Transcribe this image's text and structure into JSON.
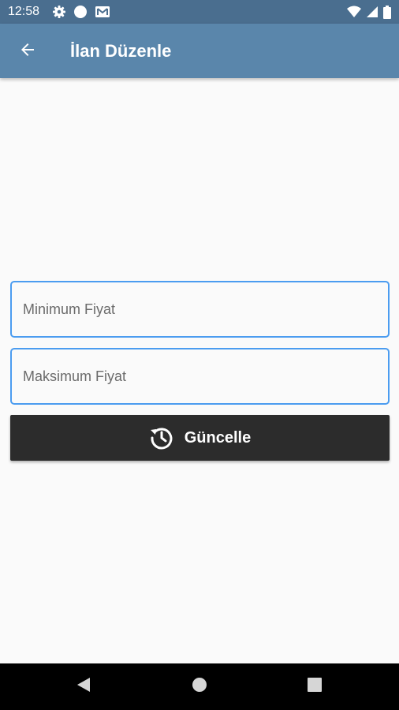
{
  "status_bar": {
    "time": "12:58",
    "left_icons": [
      "settings-icon",
      "circle-dot-icon",
      "gmail-icon"
    ],
    "right_icons": [
      "wifi-icon",
      "cell-signal-icon",
      "battery-icon"
    ]
  },
  "app_bar": {
    "title": "İlan Düzenle",
    "back_icon": "arrow-left-icon",
    "color": "#5a86ab"
  },
  "form": {
    "min_price": {
      "placeholder": "Minimum Fiyat",
      "value": ""
    },
    "max_price": {
      "placeholder": "Maksimum Fiyat",
      "value": ""
    },
    "field_border_color": "#4b9cf0"
  },
  "update_button": {
    "label": "Güncelle",
    "icon": "update-clock-icon",
    "color": "#2c2c2c"
  },
  "nav_bar": {
    "buttons": [
      "back-triangle-icon",
      "home-circle-icon",
      "recents-square-icon"
    ]
  }
}
